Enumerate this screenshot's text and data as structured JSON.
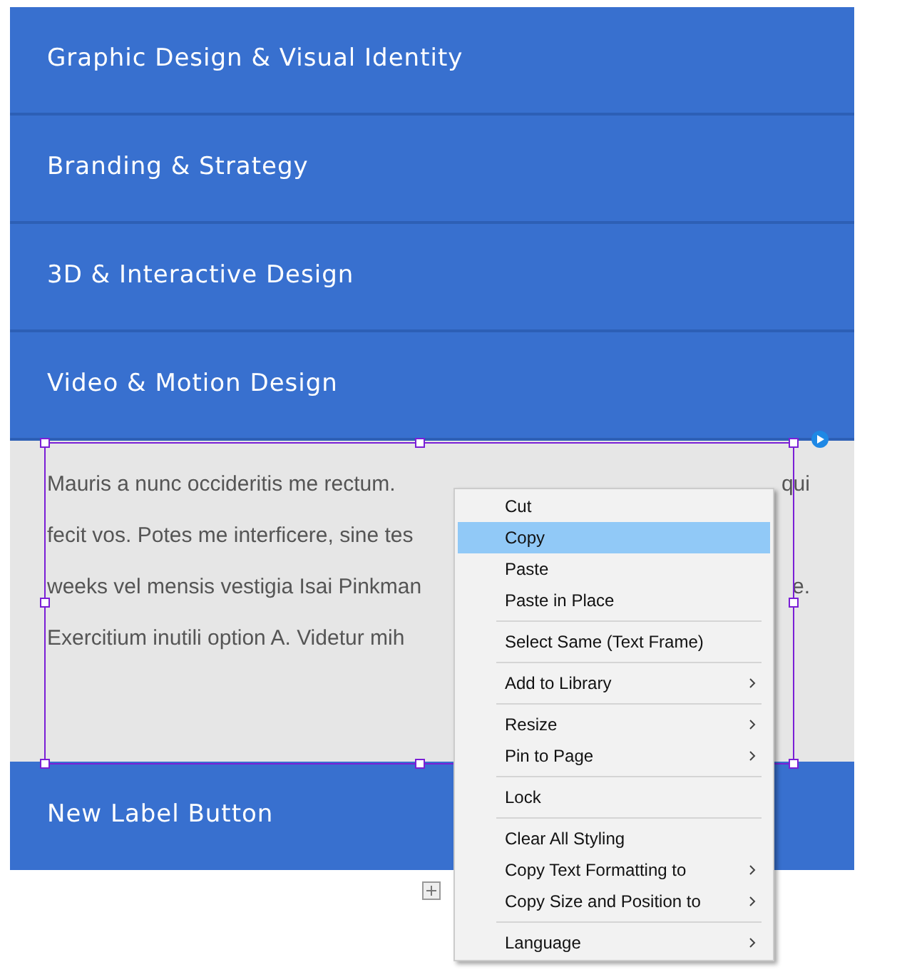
{
  "accordion": [
    {
      "label": "Graphic Design & Visual Identity"
    },
    {
      "label": "Branding & Strategy"
    },
    {
      "label": "3D & Interactive Design"
    },
    {
      "label": "Video & Motion Design"
    }
  ],
  "panel": {
    "lines": [
      {
        "text": "Mauris a nunc occideritis me rectum.",
        "tail": "qui"
      },
      {
        "text": "fecit vos. Potes me interficere, sine tes"
      },
      {
        "text": "weeks vel mensis vestigia Isai Pinkman",
        "tail": "e."
      },
      {
        "text": "Exercitium inutili option A. Videtur mih"
      }
    ]
  },
  "button": {
    "label": "New Label Button"
  },
  "context_menu": [
    {
      "kind": "item",
      "label": "Cut",
      "selected": false,
      "submenu": false
    },
    {
      "kind": "item",
      "label": "Copy",
      "selected": true,
      "submenu": false
    },
    {
      "kind": "item",
      "label": "Paste",
      "selected": false,
      "submenu": false
    },
    {
      "kind": "item",
      "label": "Paste in Place",
      "selected": false,
      "submenu": false
    },
    {
      "kind": "separator"
    },
    {
      "kind": "item",
      "label": "Select Same (Text Frame)",
      "selected": false,
      "submenu": false
    },
    {
      "kind": "separator"
    },
    {
      "kind": "item",
      "label": "Add to Library",
      "selected": false,
      "submenu": true
    },
    {
      "kind": "separator"
    },
    {
      "kind": "item",
      "label": "Resize",
      "selected": false,
      "submenu": true
    },
    {
      "kind": "item",
      "label": "Pin to Page",
      "selected": false,
      "submenu": true
    },
    {
      "kind": "separator"
    },
    {
      "kind": "item",
      "label": "Lock",
      "selected": false,
      "submenu": false
    },
    {
      "kind": "separator"
    },
    {
      "kind": "item",
      "label": "Clear All Styling",
      "selected": false,
      "submenu": false
    },
    {
      "kind": "item",
      "label": "Copy Text Formatting to",
      "selected": false,
      "submenu": true
    },
    {
      "kind": "item",
      "label": "Copy Size and Position to",
      "selected": false,
      "submenu": true
    },
    {
      "kind": "separator"
    },
    {
      "kind": "item",
      "label": "Language",
      "selected": false,
      "submenu": true
    }
  ]
}
